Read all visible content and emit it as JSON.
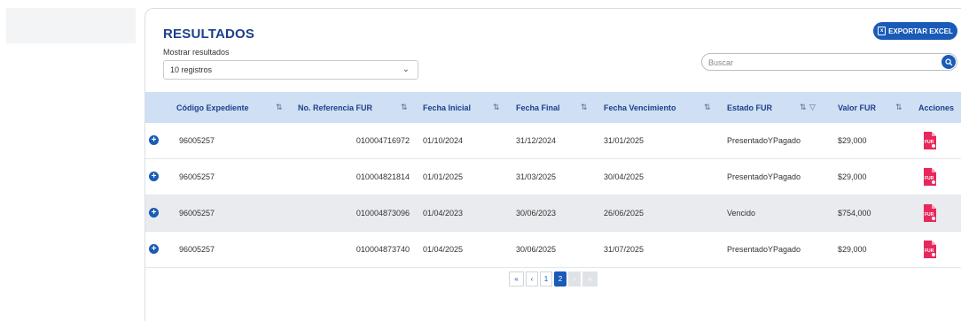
{
  "header": {
    "title": "RESULTADOS",
    "export_label": "EXPORTAR EXCEL",
    "mostrar_label": "Mostrar resultados",
    "page_size": "10 registros",
    "search_placeholder": "Buscar"
  },
  "table": {
    "columns": [
      "Código Expediente",
      "No. Referencia FUR",
      "Fecha Inicial",
      "Fecha Final",
      "Fecha Vencimiento",
      "Estado FUR",
      "Valor FUR",
      "Acciones"
    ],
    "rows": [
      {
        "codigo": "96005257",
        "referencia": "010004716972",
        "inicial": "01/10/2024",
        "final": "31/12/2024",
        "vencimiento": "31/01/2025",
        "estado": "PresentadoYPagado",
        "valor": "$29,000"
      },
      {
        "codigo": "96005257",
        "referencia": "010004821814",
        "inicial": "01/01/2025",
        "final": "31/03/2025",
        "vencimiento": "30/04/2025",
        "estado": "PresentadoYPagado",
        "valor": "$29,000"
      },
      {
        "codigo": "96005257",
        "referencia": "010004873096",
        "inicial": "01/04/2023",
        "final": "30/06/2023",
        "vencimiento": "26/06/2025",
        "estado": "Vencido",
        "valor": "$754,000"
      },
      {
        "codigo": "96005257",
        "referencia": "010004873740",
        "inicial": "01/04/2025",
        "final": "30/06/2025",
        "vencimiento": "31/07/2025",
        "estado": "PresentadoYPagado",
        "valor": "$29,000"
      }
    ],
    "action_icon_label": "FUR"
  },
  "pagination": {
    "first": "«",
    "prev": "‹",
    "pages": [
      "1",
      "2"
    ],
    "current": "2",
    "next": "›",
    "last": "»"
  },
  "colors": {
    "primary": "#1a5bb8",
    "header_bg": "#cfe0f4",
    "title": "#1c3f8c",
    "fur_icon": "#e8275b"
  },
  "icons": {
    "export": "excel-icon",
    "search": "search-icon",
    "expand": "plus-circle-icon",
    "sort": "sort-icon",
    "filter": "filter-icon",
    "action": "fur-document-icon"
  }
}
